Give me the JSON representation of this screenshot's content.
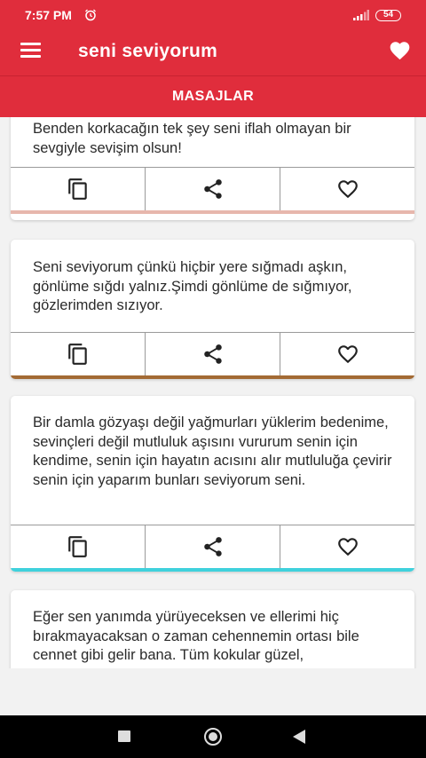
{
  "status_bar": {
    "time": "7:57 PM",
    "battery": "54"
  },
  "app_bar": {
    "title": "seni seviyorum"
  },
  "tabs": [
    {
      "label": "MASAJLAR"
    }
  ],
  "colors": {
    "primary": "#e02d3c",
    "accent_1": "#e7b7ad",
    "accent_2": "#a36a34",
    "accent_3": "#3fd1dc"
  },
  "cards": [
    {
      "text": "Benden korkacağın tek şey seni iflah olmayan bir sevgiyle sevişim olsun!",
      "accent": "#e7b7ad"
    },
    {
      "text": "Seni seviyorum çünkü hiçbir yere sığmadı aşkın, gönlüme sığdı yalnız.Şimdi gönlüme de sığmıyor, gözlerimden sızıyor.",
      "accent": "#a36a34"
    },
    {
      "text": "Bir damla gözyaşı değil yağmurları yüklerim bedenime, sevinçleri değil mutluluk aşısını vururum senin için kendime, senin için hayatın acısını alır mutluluğa çevirir senin için yaparım bunları seviyorum seni.",
      "accent": "#3fd1dc"
    },
    {
      "text": "Eğer sen yanımda yürüyeceksen ve ellerimi hiç bırakmayacaksan o zaman cehennemin ortası bile cennet gibi gelir bana. Tüm kokular güzel,",
      "accent": ""
    }
  ],
  "icons": {
    "copy": "copy-icon",
    "share": "share-icon",
    "like": "heart-outline-icon"
  }
}
